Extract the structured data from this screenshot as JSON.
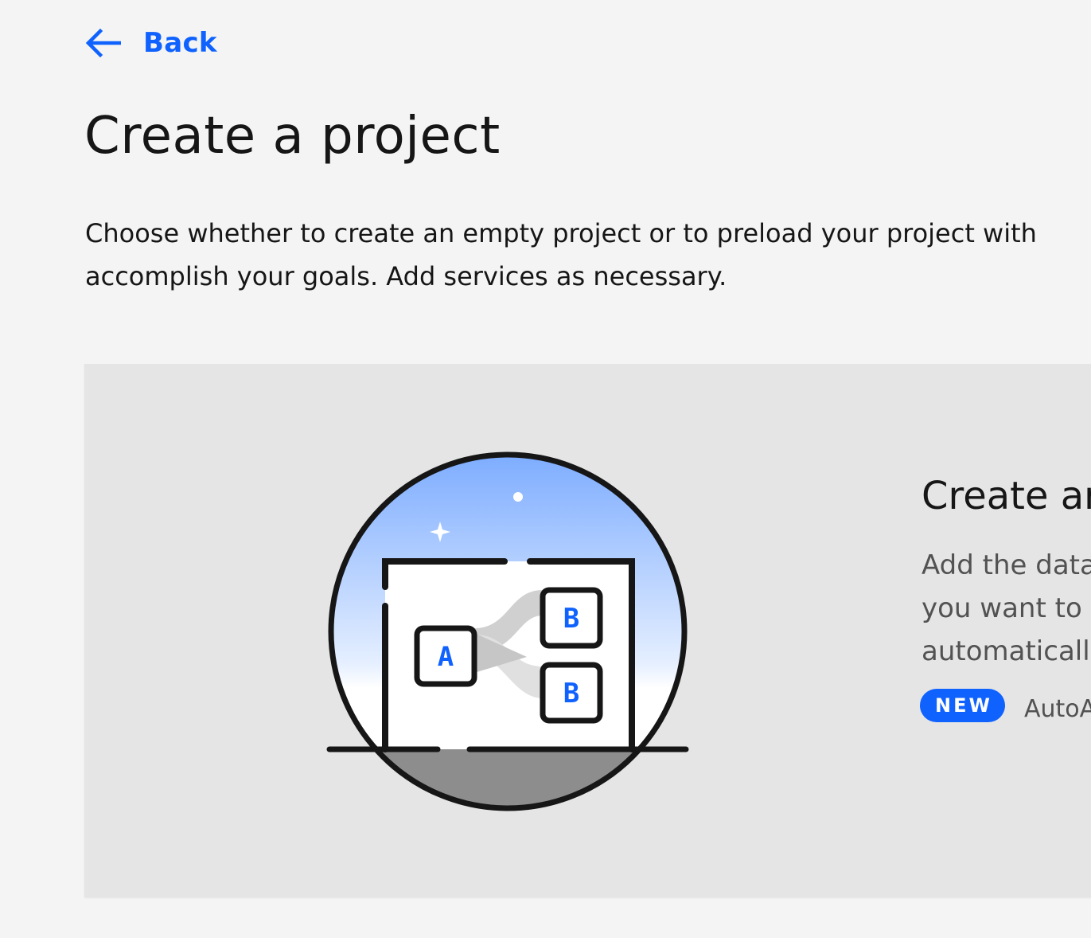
{
  "navigation": {
    "back_label": "Back"
  },
  "header": {
    "title": "Create a project",
    "description_lines": [
      "Choose whether to create an empty project or to preload your project with",
      "accomplish your goals. Add services as necessary."
    ]
  },
  "card": {
    "title": "Create ar",
    "description_lines": [
      "Add the data",
      "you want to v",
      "automaticall"
    ],
    "tag_label": "NEW",
    "tag_text": "AutoA",
    "illustration": {
      "box_a_label": "A",
      "box_b_label": "B",
      "box_b2_label": "B"
    }
  },
  "colors": {
    "accent": "#0f62fe",
    "page_background": "#f4f4f4",
    "card_background": "#e5e5e5",
    "text_primary": "#161616",
    "text_secondary": "#525252",
    "sky_top": "#7aa8fc",
    "ground": "#8d8d8d"
  },
  "icons": {
    "back": "arrow-left-icon",
    "sparkle": "sparkle-icon",
    "star": "star-dot-icon"
  }
}
